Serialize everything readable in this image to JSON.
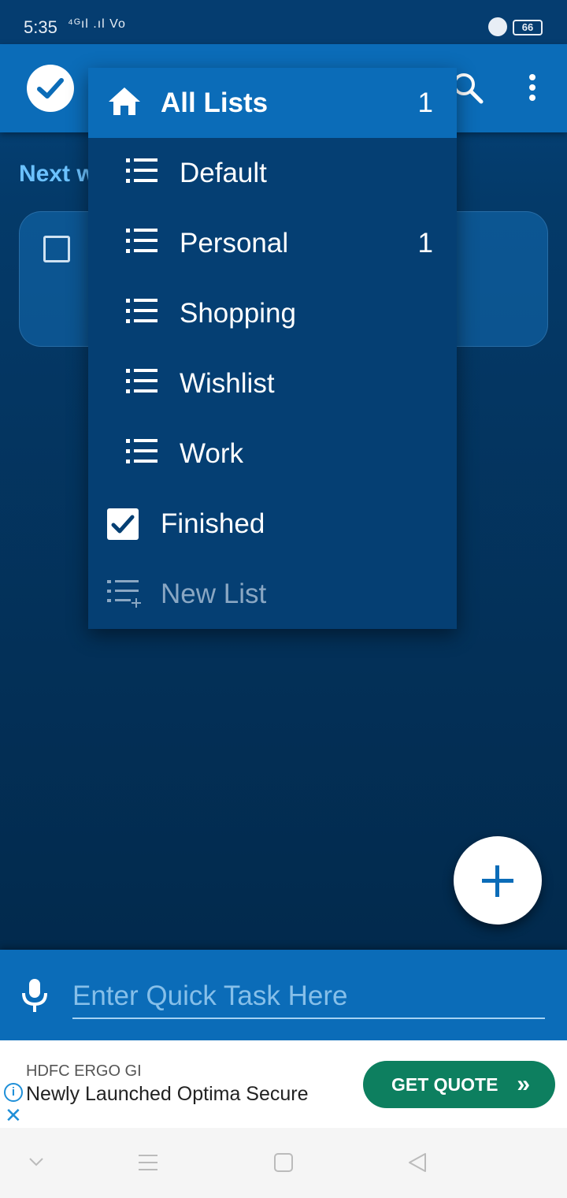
{
  "status_bar": {
    "time": "5:35",
    "signal_text": "⁴ᴳıl .ıl Vo",
    "battery": "66"
  },
  "app_bar": {
    "accent": "#0b6cb8"
  },
  "main": {
    "section_heading": "Next w"
  },
  "dropdown": {
    "items": [
      {
        "label": "All Lists",
        "count": "1",
        "icon": "home-icon"
      },
      {
        "label": "Default",
        "count": "",
        "icon": "list-icon"
      },
      {
        "label": "Personal",
        "count": "1",
        "icon": "list-icon"
      },
      {
        "label": "Shopping",
        "count": "",
        "icon": "list-icon"
      },
      {
        "label": "Wishlist",
        "count": "",
        "icon": "list-icon"
      },
      {
        "label": "Work",
        "count": "",
        "icon": "list-icon"
      },
      {
        "label": "Finished",
        "count": "",
        "icon": "checkbox-checked-icon"
      },
      {
        "label": "New List",
        "count": "",
        "icon": "playlist-add-icon"
      }
    ]
  },
  "quick_task": {
    "placeholder": "Enter Quick Task Here"
  },
  "ad": {
    "advertiser": "HDFC ERGO GI",
    "headline": "Newly Launched Optima Secure",
    "cta": "GET QUOTE",
    "cta_arrow": "»",
    "info": "i",
    "close": "✕"
  }
}
